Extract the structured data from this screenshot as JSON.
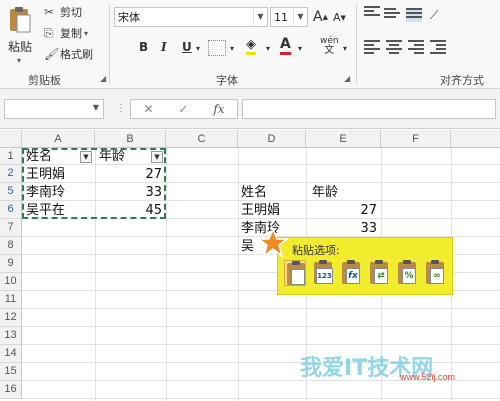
{
  "ribbon": {
    "clipboard": {
      "paste_label": "粘贴",
      "cut_label": "剪切",
      "copy_label": "复制",
      "format_painter_label": "格式刷",
      "group_label": "剪贴板"
    },
    "font": {
      "font_name": "宋体",
      "font_size": "11",
      "grow_label": "A",
      "shrink_label": "A",
      "bold": "B",
      "italic": "I",
      "underline": "U",
      "font_color_label": "A",
      "phonetic_label": "wén",
      "group_label": "字体"
    },
    "alignment": {
      "group_label": "对齐方式"
    }
  },
  "formula_bar": {
    "cancel": "✕",
    "enter": "✓",
    "fx": "fx"
  },
  "grid": {
    "columns": [
      "A",
      "B",
      "C",
      "D",
      "E",
      "F"
    ],
    "row_numbers": [
      "1",
      "2",
      "5",
      "6",
      "7",
      "8",
      "9",
      "10",
      "11",
      "12",
      "13",
      "14",
      "15",
      "16"
    ],
    "source_table": {
      "headers": [
        "姓名",
        "年龄"
      ],
      "rows": [
        [
          "王明娟",
          "27"
        ],
        [
          "李南玲",
          "33"
        ],
        [
          "吴平在",
          "45"
        ]
      ]
    },
    "pasted_table": {
      "headers": [
        "姓名",
        "年龄"
      ],
      "rows": [
        [
          "王明娟",
          "27"
        ],
        [
          "李南玲",
          "33"
        ],
        [
          "吴",
          ""
        ]
      ]
    }
  },
  "paste_options": {
    "title": "粘贴选项:",
    "options": [
      {
        "icon": "paste-icon",
        "text": ""
      },
      {
        "icon": "paste-values-icon",
        "text": "123"
      },
      {
        "icon": "paste-formulas-icon",
        "text": "fx"
      },
      {
        "icon": "paste-transpose-icon",
        "text": "⇄"
      },
      {
        "icon": "paste-formatting-icon",
        "text": "%"
      },
      {
        "icon": "paste-link-icon",
        "text": "∞"
      }
    ]
  },
  "watermark": {
    "text": "我爱IT技术网",
    "url": "www.52ij.com"
  },
  "colors": {
    "accent": "#217346",
    "marquee": "#2e7d4f",
    "paste_panel": "#f2ec2e",
    "sheet_bg": "#ffffff"
  }
}
